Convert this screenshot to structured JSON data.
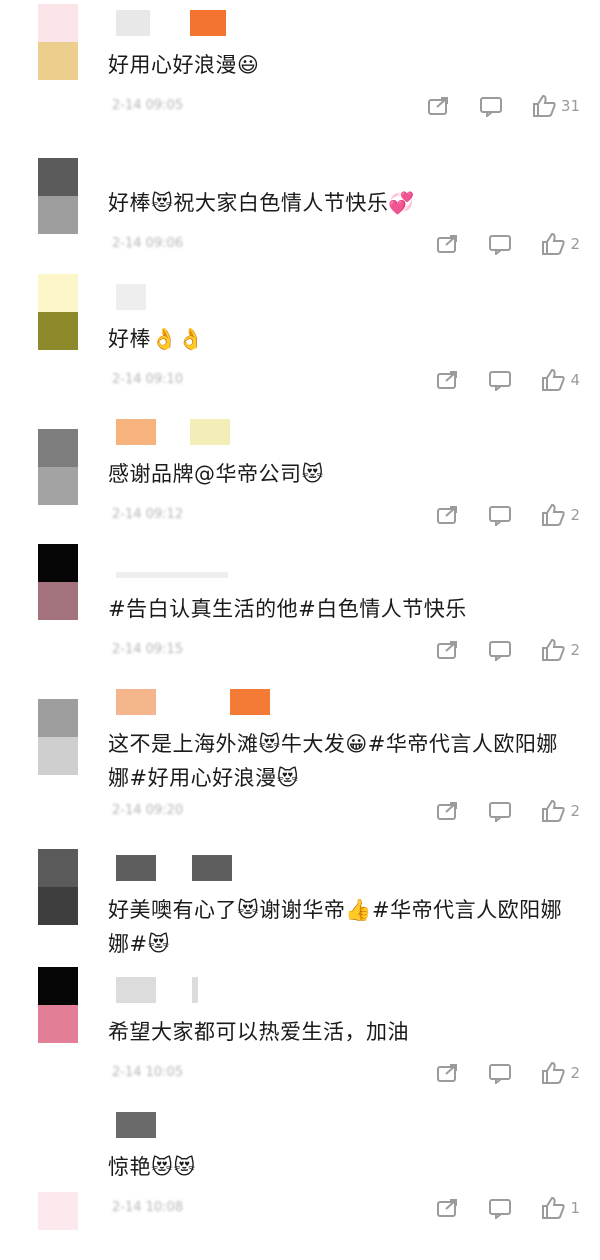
{
  "comments": [
    {
      "avatar": [
        "#fbe4e8",
        "#eccf8c"
      ],
      "name_blocks": [
        [
          "#e8e8e8",
          34
        ],
        [
          "#ffffff",
          40
        ],
        [
          "#f37430",
          36
        ]
      ],
      "text": "好用心好浪漫😃",
      "time": "2-14 09:05",
      "like_count": "31"
    },
    {
      "avatar": [
        "#5b5b5b",
        "#9e9e9e"
      ],
      "name_blocks": [],
      "text": "好棒😻祝大家白色情人节快乐💞",
      "time": "2-14 09:06",
      "like_count": "2"
    },
    {
      "avatar": [
        "#fdf6c8",
        "#8d8a2c"
      ],
      "name_blocks": [
        [
          "#eeeeee",
          30
        ]
      ],
      "text": "好棒👌👌",
      "time": "2-14 09:10",
      "like_count": "4"
    },
    {
      "avatar": [
        "#7d7d7d",
        "#a3a3a3"
      ],
      "name_blocks": [
        [
          "#f7b47e",
          40
        ],
        [
          "#ffffff",
          34
        ],
        [
          "#f3edb8",
          40
        ]
      ],
      "text": "感谢品牌@华帝公司😻",
      "time": "2-14 09:12",
      "like_count": "2"
    },
    {
      "avatar": [
        "#050505",
        "#a3727d"
      ],
      "name_blocks": [
        [
          "#eeeeee",
          112
        ]
      ],
      "text": "#告白认真生活的他#白色情人节快乐",
      "time": "2-14 09:15",
      "like_count": "2"
    },
    {
      "avatar": [
        "#9e9e9e",
        "#cfcfcf"
      ],
      "name_blocks": [
        [
          "#f5b68e",
          40
        ],
        [
          "#ffffff",
          74
        ],
        [
          "#f37b36",
          40
        ]
      ],
      "text": "这不是上海外滩😻牛大发😀#华帝代言人欧阳娜娜#好用心好浪漫😻",
      "time": "2-14 09:20",
      "like_count": "2"
    },
    {
      "avatar": [
        "#5a5a5a",
        "#3e3e3e"
      ],
      "name_blocks": [
        [
          "#5e5e5e",
          40
        ],
        [
          "#ffffff",
          36
        ],
        [
          "#5e5e5e",
          40
        ]
      ],
      "text": "好美噢有心了😻谢谢华帝👍#华帝代言人欧阳娜娜#😻",
      "time": "",
      "like_count": ""
    },
    {
      "avatar": [
        "#050505",
        "#e27f97"
      ],
      "name_blocks": [
        [
          "#dcdcdc",
          40
        ],
        [
          "#ffffff",
          36
        ],
        [
          "#dcdcdc",
          6
        ]
      ],
      "text": "希望大家都可以热爱生活，加油",
      "time": "2-14 10:05",
      "like_count": "2"
    },
    {
      "avatar": [
        "#ffffff",
        "#fbe9ee"
      ],
      "name_blocks": [
        [
          "#6a6a6a",
          40
        ]
      ],
      "text": "惊艳😻😻",
      "time": "2-14 10:08",
      "like_count": "1"
    }
  ]
}
